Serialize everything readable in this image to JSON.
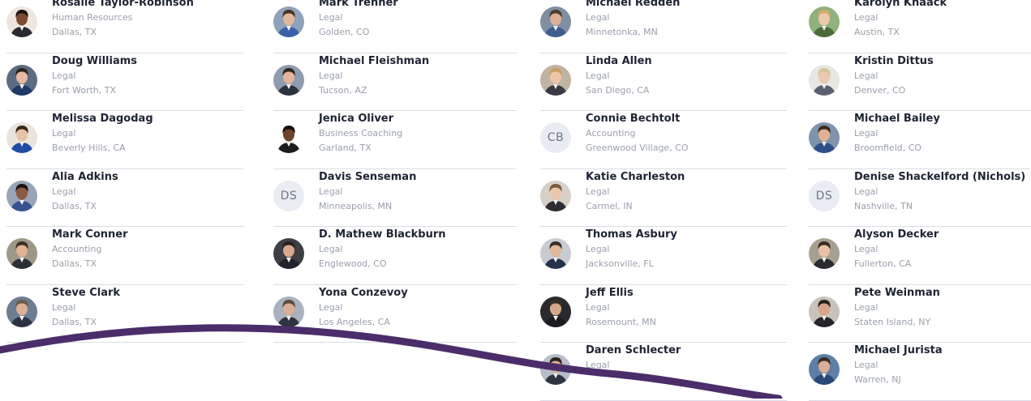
{
  "columns": [
    [
      {
        "name": "Rosalie Taylor-Robinson",
        "department": "Human Resources",
        "location": "Dallas, TX",
        "avatar": {
          "kind": "photo",
          "skin": "#7a4a32",
          "hair": "#1b1410",
          "shirt": "#2a2a33",
          "bg": "#efe7df"
        }
      },
      {
        "name": "Doug Williams",
        "department": "Legal",
        "location": "Fort Worth, TX",
        "avatar": {
          "kind": "photo",
          "skin": "#e7b9a0",
          "hair": "#2d241e",
          "shirt": "#1f3a66",
          "bg": "#5b6c82"
        }
      },
      {
        "name": "Melissa Dagodag",
        "department": "Legal",
        "location": "Beverly Hills, CA",
        "avatar": {
          "kind": "photo",
          "skin": "#e8c2a6",
          "hair": "#3a2718",
          "shirt": "#1f4da6",
          "bg": "#e9e4dc"
        }
      },
      {
        "name": "Alia Adkins",
        "department": "Legal",
        "location": "Dallas, TX",
        "avatar": {
          "kind": "photo",
          "skin": "#8b5a3e",
          "hair": "#1a1411",
          "shirt": "#35518f",
          "bg": "#98a4b7"
        }
      },
      {
        "name": "Mark Conner",
        "department": "Accounting",
        "location": "Dallas, TX",
        "avatar": {
          "kind": "photo",
          "skin": "#dfb396",
          "hair": "#3b2d22",
          "shirt": "#2b3038",
          "bg": "#9d9788"
        }
      },
      {
        "name": "Steve Clark",
        "department": "Legal",
        "location": "Dallas, TX",
        "avatar": {
          "kind": "photo",
          "skin": "#dcae93",
          "hair": "#6b5a4a",
          "shirt": "#2c3442",
          "bg": "#6b7d92"
        }
      }
    ],
    [
      {
        "name": "Mark Trenner",
        "department": "Legal",
        "location": "Golden, CO",
        "avatar": {
          "kind": "photo",
          "skin": "#e5b89b",
          "hair": "#4a3525",
          "shirt": "#3861a8",
          "bg": "#8fa2bb"
        }
      },
      {
        "name": "Michael Fleishman",
        "department": "Legal",
        "location": "Tucson, AZ",
        "avatar": {
          "kind": "photo",
          "skin": "#e4b59a",
          "hair": "#2e2620",
          "shirt": "#2c3340",
          "bg": "#8f9cae"
        }
      },
      {
        "name": "Jenica Oliver",
        "department": "Business Coaching",
        "location": "Garland, TX",
        "avatar": {
          "kind": "photo",
          "skin": "#6d432d",
          "hair": "#15100d",
          "shirt": "#1c1c1f",
          "bg": "#ffffff"
        }
      },
      {
        "name": "Davis Senseman",
        "department": "Legal",
        "location": "Minneapolis, MN",
        "avatar": {
          "kind": "initials",
          "text": "DS"
        }
      },
      {
        "name": "D. Mathew Blackburn",
        "department": "Legal",
        "location": "Englewood, CO",
        "avatar": {
          "kind": "photo",
          "skin": "#d9a98d",
          "hair": "#2a221c",
          "shirt": "#20232a",
          "bg": "#3e3f44"
        }
      },
      {
        "name": "Yona Conzevoy",
        "department": "Legal",
        "location": "Los Angeles, CA",
        "avatar": {
          "kind": "photo",
          "skin": "#dcae93",
          "hair": "#5b4a3a",
          "shirt": "#2f3440",
          "bg": "#a9b2be"
        }
      }
    ],
    [
      {
        "name": "Michael Redden",
        "department": "Legal",
        "location": "Minnetonka, MN",
        "avatar": {
          "kind": "photo",
          "skin": "#dcb094",
          "hair": "#4e3b2d",
          "shirt": "#3f5e8c",
          "bg": "#7f8fa3"
        }
      },
      {
        "name": "Linda Allen",
        "department": "Legal",
        "location": "San Diego, CA",
        "avatar": {
          "kind": "photo",
          "skin": "#ecc5a7",
          "hair": "#caa05e",
          "shirt": "#3a3a44",
          "bg": "#bfb4a4"
        }
      },
      {
        "name": "Connie Bechtolt",
        "department": "Accounting",
        "location": "Greenwood Village, CO",
        "avatar": {
          "kind": "initials",
          "text": "CB"
        }
      },
      {
        "name": "Katie Charleston",
        "department": "Legal",
        "location": "Carmel, IN",
        "avatar": {
          "kind": "photo",
          "skin": "#ecc6ab",
          "hair": "#7a5a3c",
          "shirt": "#2d2d33",
          "bg": "#d6d0c8"
        }
      },
      {
        "name": "Thomas Asbury",
        "department": "Legal",
        "location": "Jacksonville, FL",
        "avatar": {
          "kind": "photo",
          "skin": "#e3b79c",
          "hair": "#3a2e25",
          "shirt": "#23324d",
          "bg": "#c8ccd2"
        }
      },
      {
        "name": "Jeff Ellis",
        "department": "Legal",
        "location": "Rosemount, MN",
        "avatar": {
          "kind": "photo",
          "skin": "#d8a88b",
          "hair": "#3a2e25",
          "shirt": "#1b1b20",
          "bg": "#2a2a2e"
        }
      },
      {
        "name": "Daren Schlecter",
        "department": "Legal",
        "location": "",
        "avatar": {
          "kind": "photo",
          "skin": "#d9ad91",
          "hair": "#2d2520",
          "shirt": "#2e3440",
          "bg": "#b8bec7"
        }
      }
    ],
    [
      {
        "name": "Karolyn Knaack",
        "department": "Legal",
        "location": "Austin, TX",
        "avatar": {
          "kind": "photo",
          "skin": "#efc9ad",
          "hair": "#d0ad6f",
          "shirt": "#4d6b3a",
          "bg": "#8fb17c"
        }
      },
      {
        "name": "Kristin Dittus",
        "department": "Legal",
        "location": "Denver, CO",
        "avatar": {
          "kind": "photo",
          "skin": "#edc9af",
          "hair": "#d7c39c",
          "shirt": "#5a6270",
          "bg": "#e8e6e2"
        }
      },
      {
        "name": "Michael Bailey",
        "department": "Legal",
        "location": "Broomfield, CO",
        "avatar": {
          "kind": "photo",
          "skin": "#e3b093",
          "hair": "#3c2a1e",
          "shirt": "#2f4f88",
          "bg": "#7f93ad"
        }
      },
      {
        "name": "Denise Shackelford (Nichols)",
        "department": "Legal",
        "location": "Nashville, TN",
        "avatar": {
          "kind": "initials",
          "text": "DS"
        }
      },
      {
        "name": "Alyson Decker",
        "department": "Legal",
        "location": "Fullerton, CA",
        "avatar": {
          "kind": "photo",
          "skin": "#e9c1a5",
          "hair": "#3a2a1e",
          "shirt": "#2c2c30",
          "bg": "#a7a092"
        }
      },
      {
        "name": "Pete Weinman",
        "department": "Legal",
        "location": "Staten Island, NY",
        "avatar": {
          "kind": "photo",
          "skin": "#d6a488",
          "hair": "#2a211b",
          "shirt": "#25262b",
          "bg": "#c8c3ba"
        }
      },
      {
        "name": "Michael Jurista",
        "department": "Legal",
        "location": "Warren, NJ",
        "avatar": {
          "kind": "photo",
          "skin": "#dcae93",
          "hair": "#3a2d22",
          "shirt": "#2b4878",
          "bg": "#5e7fa6"
        }
      }
    ]
  ],
  "colors": {
    "wave": "#4b2d6a",
    "divider": "#d9dde4",
    "name": "#1e2433",
    "meta": "#9aa0ab"
  }
}
